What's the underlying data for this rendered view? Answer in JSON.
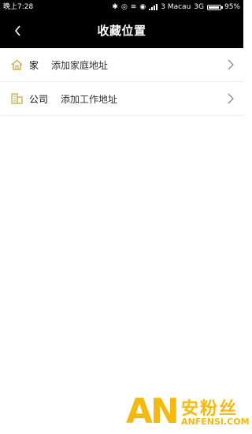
{
  "status_bar": {
    "time": "晚上7:28",
    "carrier": "3 Macau",
    "network": "3G",
    "battery_percent": "95%",
    "battery_level": 0.95
  },
  "header": {
    "title": "收藏位置"
  },
  "locations": [
    {
      "label": "家",
      "action": "添加家庭地址",
      "icon": "home-icon"
    },
    {
      "label": "公司",
      "action": "添加工作地址",
      "icon": "building-icon"
    }
  ],
  "colors": {
    "header_bg": "#000000",
    "icon_accent": "#c9a23a",
    "watermark": "#f2b90f"
  },
  "watermark": {
    "logo": "AN",
    "brand": "安粉丝",
    "site": "ANFENSI.COM"
  }
}
